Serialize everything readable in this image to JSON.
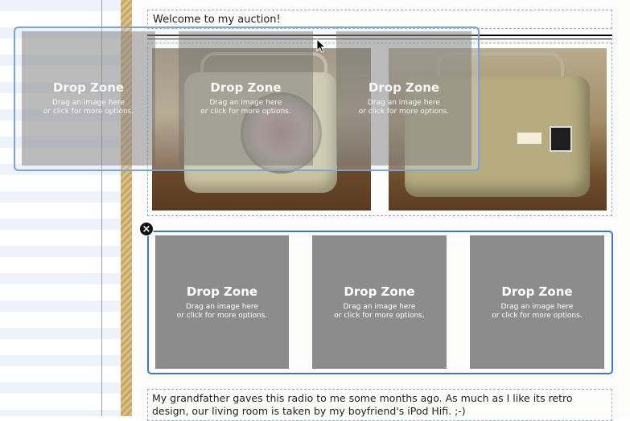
{
  "welcome_text": "Welcome to my auction!",
  "drop_zone": {
    "title": "Drop Zone",
    "line1": "Drag an image here",
    "line2": "or click for more options."
  },
  "description": "My grandfather gaves this radio to me some months ago. As much as I like its retro design, our living room is taken by my boyfriend's iPod Hifi. ;-)",
  "close_icon": "×",
  "colors": {
    "selection_border": "#3c78c3",
    "drop_zone_fill": "#8c8c8c"
  }
}
